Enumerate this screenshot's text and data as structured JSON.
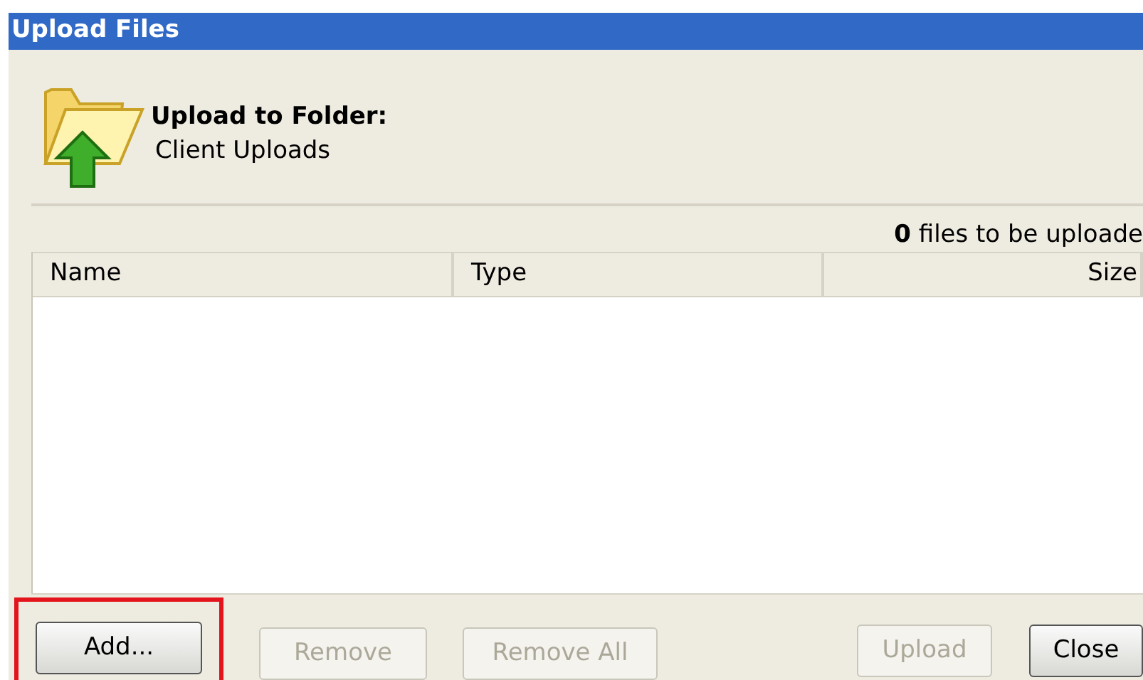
{
  "window": {
    "title": "Upload Files"
  },
  "destination": {
    "heading": "Upload to Folder:",
    "folder": "Client Uploads"
  },
  "status": "**0** files to be uploade",
  "table": {
    "columns": [
      "Name",
      "Type",
      "Size"
    ]
  },
  "left_buttons": [
    {
      "label": "Add...",
      "disabled": false,
      "highlighted": true
    },
    {
      "label": "Remove",
      "disabled": true,
      "highlighted": false
    },
    {
      "label": "Remove All",
      "disabled": true,
      "highlighted": false
    }
  ],
  "right_buttons": [
    {
      "label": "Upload",
      "disabled": true,
      "highlighted": false
    },
    {
      "label": "Close",
      "disabled": false,
      "highlighted": false
    }
  ]
}
